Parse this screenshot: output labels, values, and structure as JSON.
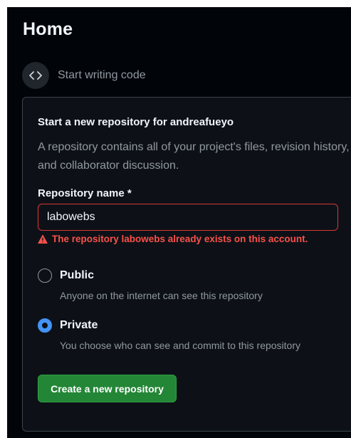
{
  "page": {
    "title": "Home"
  },
  "start": {
    "icon": "code-icon",
    "label": "Start writing code"
  },
  "new_repo": {
    "title": "Start a new repository for andreafueyo",
    "description": "A repository contains all of your project's files, revision history, and collaborator discussion.",
    "name_label": "Repository name *",
    "name_value": "labowebs",
    "error_icon": "alert-icon",
    "error_message": "The repository labowebs already exists on this account.",
    "visibility": [
      {
        "label": "Public",
        "description": "Anyone on the internet can see this repository",
        "selected": false
      },
      {
        "label": "Private",
        "description": "You choose who can see and commit to this repository",
        "selected": true
      }
    ],
    "create_button": "Create a new repository"
  },
  "colors": {
    "background": "#010409",
    "card": "#0d1117",
    "border": "#3d444d",
    "error": "#f85149",
    "error_border": "#da3633",
    "radio_selected": "#4493f8",
    "primary_button": "#238636",
    "muted_text": "#9198a1",
    "text": "#f0f6fc"
  }
}
